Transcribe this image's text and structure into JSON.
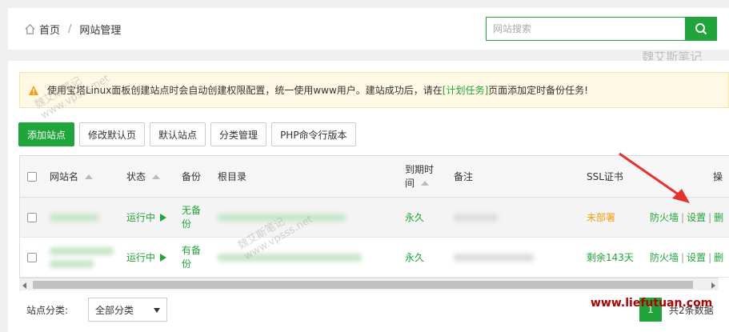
{
  "breadcrumb": {
    "home": "首页",
    "separator": "/",
    "current": "网站管理"
  },
  "search": {
    "placeholder": "网站搜索"
  },
  "alert": {
    "text_before": "使用宝塔Linux面板创建站点时会自动创建权限配置，统一使用www用户。建站成功后，请在",
    "link": "[计划任务]",
    "text_after": "页面添加定时备份任务!"
  },
  "toolbar": [
    "添加站点",
    "修改默认页",
    "默认站点",
    "分类管理",
    "PHP命令行版本"
  ],
  "table": {
    "headers": {
      "name": "网站名",
      "status": "状态",
      "backup": "备份",
      "root": "根目录",
      "expire_1": "到期时",
      "expire_2": "间",
      "remark": "备注",
      "ssl": "SSL证书",
      "ops": "操"
    },
    "rows": [
      {
        "status": "运行中",
        "backup_1": "无备",
        "backup_2": "份",
        "expire": "永久",
        "ssl": "未部署",
        "op_firewall": "防火墙",
        "op_settings": "设置",
        "op_more": "删"
      },
      {
        "status": "运行中",
        "backup_1": "有备",
        "backup_2": "份",
        "expire": "永久",
        "ssl": "剩余143天",
        "op_firewall": "防火墙",
        "op_settings": "设置",
        "op_more": "删"
      }
    ]
  },
  "footer": {
    "category_label": "站点分类:",
    "category_value": "全部分类",
    "page": "1",
    "total": "共2条数据"
  },
  "watermarks": {
    "top_line1": "魏艾斯笔记",
    "top_line2": "www.vpsss.net",
    "brand": "www.liefutuan.com"
  },
  "colors": {
    "accent": "#20a53a",
    "warning": "#f39c12",
    "annotation_arrow": "#e8312f"
  }
}
